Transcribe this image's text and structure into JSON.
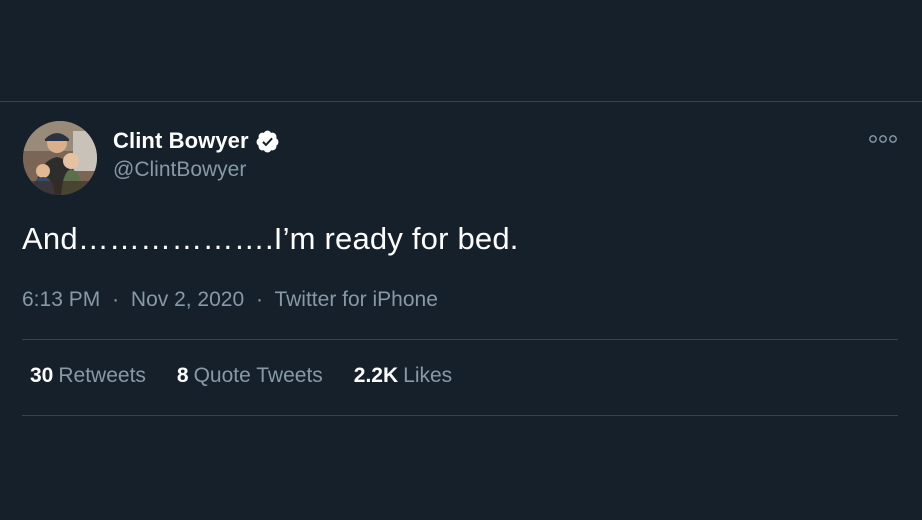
{
  "tweet": {
    "display_name": "Clint Bowyer",
    "handle": "@ClintBowyer",
    "text": "And……………….I’m ready for bed.",
    "time": "6:13 PM",
    "date": "Nov 2, 2020",
    "source": "Twitter for iPhone",
    "meta_separator": "·"
  },
  "stats": {
    "retweets": {
      "count": "30",
      "label": "Retweets"
    },
    "quote_tweets": {
      "count": "8",
      "label": "Quote Tweets"
    },
    "likes": {
      "count": "2.2K",
      "label": "Likes"
    }
  },
  "icons": {
    "verified": "verified-badge-icon",
    "more": "more-options-icon"
  },
  "colors": {
    "background": "#15202b",
    "secondary_text": "#8899a6",
    "divider": "#38444d"
  }
}
